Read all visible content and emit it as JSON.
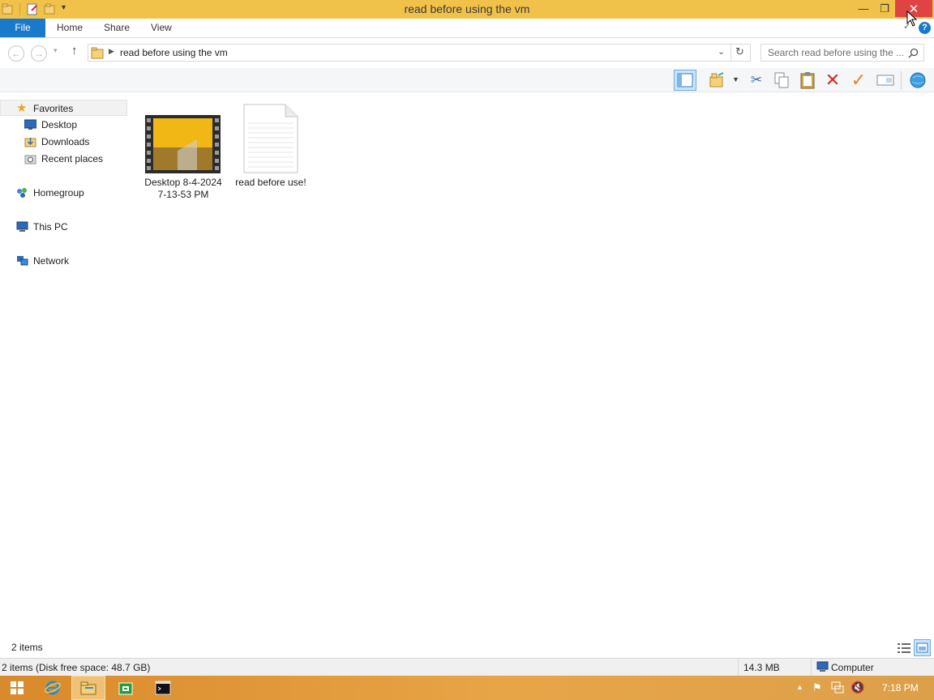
{
  "window": {
    "title": "read before using the vm"
  },
  "ribbon": {
    "tabs": [
      "File",
      "Home",
      "Share",
      "View"
    ]
  },
  "address": {
    "path": "read before using the vm",
    "search_placeholder": "Search read before using the ..."
  },
  "nav": {
    "favorites": "Favorites",
    "favorites_children": [
      "Desktop",
      "Downloads",
      "Recent places"
    ],
    "homegroup": "Homegroup",
    "this_pc": "This PC",
    "network": "Network"
  },
  "files": [
    {
      "line1": "Desktop 8-4-2024",
      "line2": "7-13-53 PM",
      "icon": "video-file-icon"
    },
    {
      "line1": "read before use!",
      "line2": "",
      "icon": "text-file-icon"
    }
  ],
  "status": {
    "item_count": "2 items",
    "details_left": "2 items (Disk free space: 48.7 GB)",
    "details_size": "14.3 MB",
    "details_location": "Computer"
  },
  "taskbar": {
    "clock": "7:18 PM"
  },
  "colors": {
    "titlebar": "#f1c24a",
    "file_tab": "#1979ca",
    "close": "#e04343",
    "taskbar": "#e29a36"
  }
}
